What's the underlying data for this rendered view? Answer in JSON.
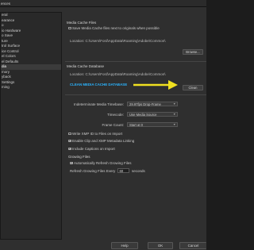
{
  "window": {
    "title": "ences"
  },
  "sidebar": {
    "items": [
      {
        "label": "eral"
      },
      {
        "label": "earance"
      },
      {
        "label": "o"
      },
      {
        "label": "io Hardware"
      },
      {
        "label": "o Save"
      },
      {
        "label": "ture"
      },
      {
        "label": "trol Surface"
      },
      {
        "label": "ice Control"
      },
      {
        "label": "el Colors"
      },
      {
        "label": "el Defaults"
      },
      {
        "label": "dia"
      },
      {
        "label": "mory"
      },
      {
        "label": "yback"
      },
      {
        "label": "Settings"
      },
      {
        "label": "ming"
      }
    ],
    "selected_index": 10
  },
  "media_cache_files": {
    "title": "Media Cache Files",
    "save_checkbox_label": "Save Media Cache files next to originals when possible",
    "location": "Location:  C:\\Users\\Ford\\AppData\\Roaming\\Adobe\\Common\\",
    "browse_label": "Browse..."
  },
  "media_cache_database": {
    "title": "Media Cache Database",
    "location": "Location:  C:\\Users\\Ford\\AppData\\Roaming\\Adobe\\Common\\",
    "annotation": "CLEAN MEDIA CACHE DATABASE",
    "annotation_color": "#2ab4ff",
    "arrow_color": "#f0e020",
    "clean_label": "Clean"
  },
  "settings": {
    "timebase_label": "Indeterminate Media Timebase:",
    "timebase_value": "29.97fps Drop-Frame",
    "timecode_label": "Timecode:",
    "timecode_value": "Use Media Source",
    "frame_count_label": "Frame Count:",
    "frame_count_value": "Start at 0"
  },
  "checkboxes": {
    "write_xmp": "Write XMP ID to Files on Import",
    "enable_clip": "Enable Clip and XMP Metadata Linking",
    "include_captions": "Include Captions on Import"
  },
  "growing_files": {
    "title": "Growing Files",
    "auto_refresh_label": "Automatically Refresh Growing Files",
    "refresh_every_label": "Refresh Growing Files Every",
    "refresh_value": "60",
    "seconds_label": "seconds"
  },
  "footer": {
    "help_label": "Help",
    "ok_label": "OK",
    "cancel_label": "Cancel"
  }
}
